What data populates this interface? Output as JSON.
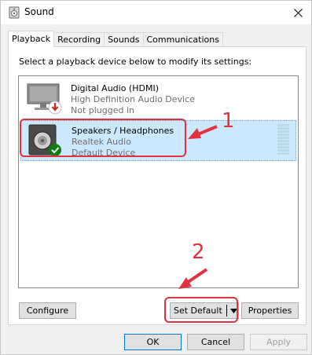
{
  "window": {
    "title": "Sound",
    "close_icon": "close-icon",
    "app_icon": "speaker-icon"
  },
  "tabs": [
    {
      "label": "Playback",
      "active": true
    },
    {
      "label": "Recording",
      "active": false
    },
    {
      "label": "Sounds",
      "active": false
    },
    {
      "label": "Communications",
      "active": false
    }
  ],
  "panel": {
    "instruction": "Select a playback device below to modify its settings:"
  },
  "devices": [
    {
      "name": "Digital Audio (HDMI)",
      "description": "High Definition Audio Device",
      "status": "Not plugged in",
      "icon": "monitor-icon",
      "badge": "down-arrow-badge",
      "selected": false
    },
    {
      "name": "Speakers / Headphones",
      "description": "Realtek Audio",
      "status": "Default Device",
      "icon": "speaker-icon",
      "badge": "checkmark-badge",
      "selected": true
    }
  ],
  "annotations": {
    "first": "1",
    "second": "2",
    "color": "#e1323d"
  },
  "buttons": {
    "configure": "Configure",
    "set_default": "Set Default",
    "properties": "Properties",
    "ok": "OK",
    "cancel": "Cancel",
    "apply": "Apply"
  },
  "colors": {
    "selection": "#cce8ff",
    "accent": "#0078d7",
    "annotation": "#e1323d",
    "badge_ok": "#107c10",
    "badge_unplugged": "#c42b1c"
  }
}
